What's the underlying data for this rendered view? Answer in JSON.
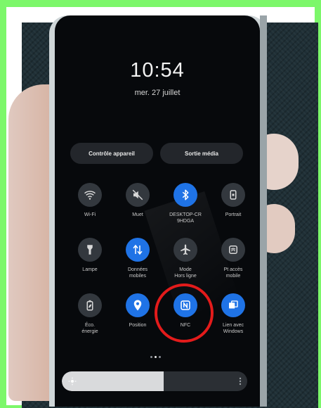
{
  "clock": {
    "time": "10:54",
    "date": "mer. 27 juillet"
  },
  "quick_buttons": {
    "device_control": "Contrôle appareil",
    "media_output": "Sortie média"
  },
  "tiles": [
    {
      "id": "wifi",
      "label": "Wi-Fi",
      "state": "off",
      "icon": "wifi-icon"
    },
    {
      "id": "mute",
      "label": "Muet",
      "state": "off",
      "icon": "mute-icon"
    },
    {
      "id": "bluetooth",
      "label": "DESKTOP-CR\n9HDGA",
      "state": "on",
      "icon": "bluetooth-icon"
    },
    {
      "id": "portrait",
      "label": "Portrait",
      "state": "off",
      "icon": "portrait-lock-icon"
    },
    {
      "id": "flashlight",
      "label": "Lampe",
      "state": "off",
      "icon": "flashlight-icon"
    },
    {
      "id": "mobile-data",
      "label": "Données\nmobiles",
      "state": "on",
      "icon": "mobile-data-icon"
    },
    {
      "id": "airplane",
      "label": "Mode\nHors ligne",
      "state": "off",
      "icon": "airplane-icon"
    },
    {
      "id": "hotspot",
      "label": "Pt accès\nmobile",
      "state": "off",
      "icon": "hotspot-icon"
    },
    {
      "id": "power-saving",
      "label": "Éco.\nénergie",
      "state": "off",
      "icon": "battery-leaf-icon"
    },
    {
      "id": "location",
      "label": "Position",
      "state": "on",
      "icon": "location-pin-icon"
    },
    {
      "id": "nfc",
      "label": "NFC",
      "state": "on",
      "icon": "nfc-icon"
    },
    {
      "id": "link-windows",
      "label": "Lien avec\nWindows",
      "state": "on",
      "icon": "link-windows-icon"
    }
  ],
  "pager": {
    "count": 3,
    "active": 1
  },
  "brightness": {
    "level": 0.55
  },
  "colors": {
    "accent": "#1f73e6",
    "highlight": "#e31b1b",
    "border": "#7cf76a"
  }
}
